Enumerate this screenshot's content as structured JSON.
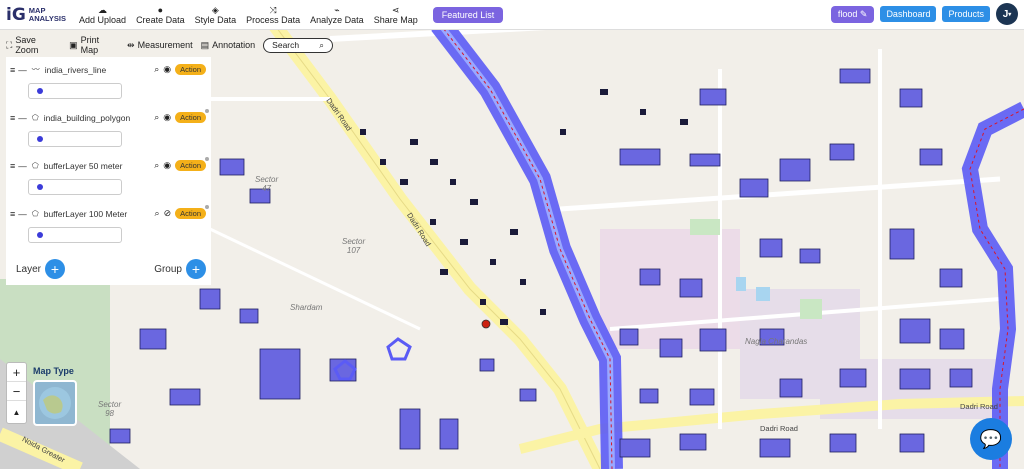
{
  "header": {
    "logo_mark": "iG",
    "logo_line1": "MAP",
    "logo_line2": "ANALYSIS",
    "nav": [
      {
        "label": "Add Upload",
        "icon": "upload-cloud-icon",
        "glyph": "☁"
      },
      {
        "label": "Create Data",
        "icon": "map-pin-icon",
        "glyph": "📍"
      },
      {
        "label": "Style Data",
        "icon": "paint-bucket-icon",
        "glyph": "◈"
      },
      {
        "label": "Process Data",
        "icon": "process-icon",
        "glyph": "⤨"
      },
      {
        "label": "Analyze Data",
        "icon": "analyze-icon",
        "glyph": "⌁"
      },
      {
        "label": "Share Map",
        "icon": "share-icon",
        "glyph": "⋖"
      }
    ],
    "featured_label": "Featured List",
    "project_label": "flood",
    "dashboard_label": "Dashboard",
    "products_label": "Products",
    "avatar_letter": "J"
  },
  "toolbar": {
    "save_zoom": "Save Zoom",
    "print_map": "Print Map",
    "measurement": "Measurement",
    "annotation": "Annotation",
    "search": "Search"
  },
  "layers": [
    {
      "name": "india_rivers_line",
      "type_icon": "line-icon",
      "visible": true,
      "action": "Action"
    },
    {
      "name": "india_building_polygon",
      "type_icon": "polygon-icon",
      "visible": true,
      "action": "Action"
    },
    {
      "name": "bufferLayer 50 meter",
      "type_icon": "polygon-icon",
      "visible": true,
      "action": "Action"
    },
    {
      "name": "bufferLayer 100 Meter",
      "type_icon": "polygon-icon",
      "visible": false,
      "action": "Action"
    }
  ],
  "panel_footer": {
    "layer_label": "Layer",
    "group_label": "Group"
  },
  "map_type_label": "Map Type",
  "map_labels": {
    "sector47": "Sector\n47",
    "sector107": "Sector\n107",
    "sector98": "Sector\n98",
    "shardam": "Shardam",
    "dadri_road_1": "Dadri Road",
    "dadri_road_2": "Dadri Road",
    "dadri_road_3": "Dadri Road",
    "dadri_road_4": "Dadri Road",
    "noida_greater": "Noida Greater",
    "nagla": "Nagla Charandas"
  },
  "colors": {
    "accent": "#7b64e0",
    "blue": "#2d8fe6",
    "building": "#6a67e0",
    "river_buffer": "#5b5bf5",
    "action": "#f4b019"
  }
}
